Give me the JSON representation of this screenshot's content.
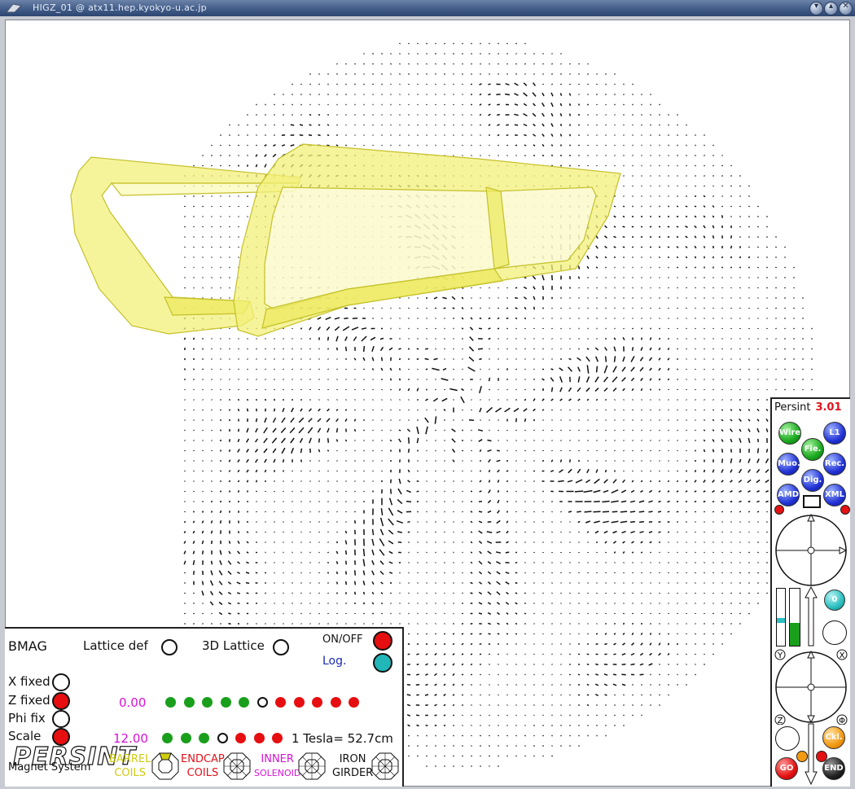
{
  "window": {
    "title": "HIGZ_01 @ atx11.hep.kyokyo-u.ac.jp"
  },
  "panel": {
    "app": "Persint",
    "version": "3.01",
    "buttons": [
      "Wire",
      "Fie.",
      "L1",
      "Muo.",
      "Dig.",
      "Rec.",
      "AMD",
      "XML"
    ],
    "small_button": "0",
    "axes": [
      "Y",
      "X",
      "Z",
      "Φ"
    ],
    "bottom_buttons": [
      "Ckl.",
      "GO",
      "END"
    ]
  },
  "bmag": {
    "title": "BMAG",
    "lattice_def": "Lattice def",
    "lattice_3d": "3D Lattice",
    "on_off": "ON/OFF",
    "log": "Log.",
    "x_fixed": "X fixed",
    "z_fixed": "Z fixed",
    "phi_fix": "Phi fix",
    "scale": "Scale",
    "value_z": "0.00",
    "value_scale": "12.00",
    "tesla": "1 Tesla= 52.7cm",
    "logo": "PERSINT",
    "subsystem": "Magnet System",
    "legend": [
      {
        "line1": "BARREL",
        "line2": "COILS",
        "color": "#cfcc0e"
      },
      {
        "line1": "ENDCAP",
        "line2": "COILS",
        "color": "#e2101a"
      },
      {
        "line1": "INNER",
        "line2": "SOLENOID",
        "color": "#d613d6"
      },
      {
        "line1": "IRON",
        "line2": "GIRDER",
        "color": "#111111"
      }
    ]
  },
  "colors": {
    "coil_fill": "#f3f07a",
    "coil_stroke": "#c4c02a",
    "field": "#111111"
  }
}
